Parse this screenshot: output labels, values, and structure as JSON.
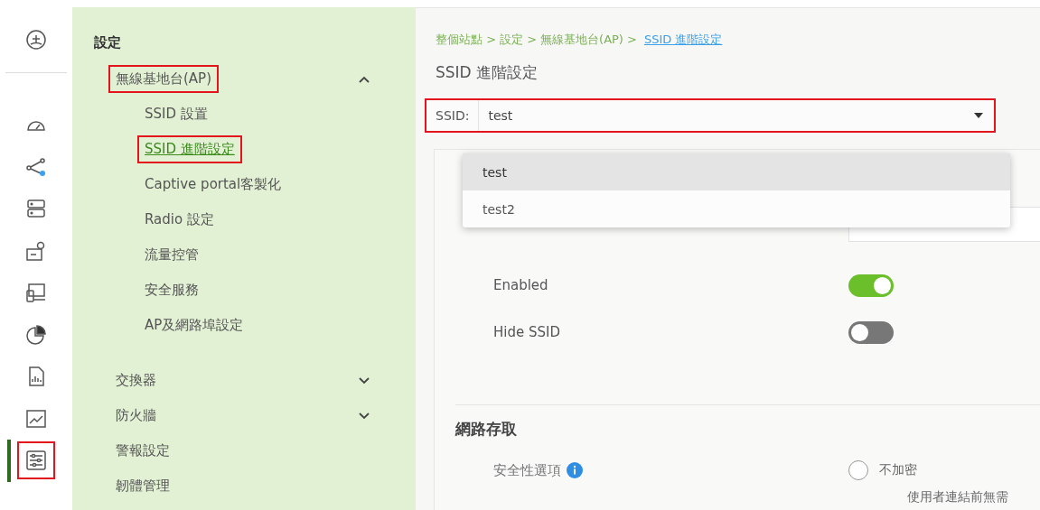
{
  "rail": [
    {
      "kind": "logo",
      "selected": false,
      "highlighted": false
    },
    {
      "kind": "gauge",
      "selected": false,
      "highlighted": false
    },
    {
      "kind": "topology",
      "selected": false,
      "highlighted": false
    },
    {
      "kind": "server",
      "selected": false,
      "highlighted": false
    },
    {
      "kind": "location",
      "selected": false,
      "highlighted": false
    },
    {
      "kind": "devices",
      "selected": false,
      "highlighted": false
    },
    {
      "kind": "pie",
      "selected": false,
      "highlighted": false
    },
    {
      "kind": "report",
      "selected": false,
      "highlighted": false
    },
    {
      "kind": "chart",
      "selected": false,
      "highlighted": false
    },
    {
      "kind": "sliders",
      "selected": true,
      "highlighted": true
    }
  ],
  "nav": {
    "title": "設定",
    "items": [
      {
        "kind": "group",
        "label": "無線基地台(AP)",
        "expanded": true,
        "highlighted": true,
        "children": [
          {
            "label": "SSID 設置",
            "selected": false,
            "highlighted": false
          },
          {
            "label": "SSID 進階設定",
            "selected": true,
            "highlighted": true
          },
          {
            "label": "Captive portal客製化",
            "selected": false,
            "highlighted": false
          },
          {
            "label": "Radio 設定",
            "selected": false,
            "highlighted": false
          },
          {
            "label": "流量控管",
            "selected": false,
            "highlighted": false
          },
          {
            "label": "安全服務",
            "selected": false,
            "highlighted": false
          },
          {
            "label": "AP及網路埠設定",
            "selected": false,
            "highlighted": false
          }
        ]
      },
      {
        "kind": "group",
        "label": "交換器",
        "expanded": false,
        "highlighted": false
      },
      {
        "kind": "group",
        "label": "防火牆",
        "expanded": false,
        "highlighted": false
      },
      {
        "kind": "item",
        "label": "警報設定",
        "highlighted": false
      },
      {
        "kind": "item",
        "label": "韌體管理",
        "highlighted": false
      }
    ]
  },
  "breadcrumb": {
    "parts": [
      "整個站點 >",
      "設定 >",
      "無線基地台(AP) >"
    ],
    "current": "SSID 進階設定"
  },
  "title": "SSID 進階設定",
  "select": {
    "label": "SSID:",
    "value": "test",
    "highlighted": true,
    "open": true,
    "options": [
      {
        "label": "test",
        "selected": true
      },
      {
        "label": "test2",
        "selected": false
      }
    ]
  },
  "toggles": [
    {
      "label": "Enabled",
      "on": true
    },
    {
      "label": "Hide SSID",
      "on": false
    }
  ],
  "access": {
    "title": "網路存取",
    "security_label": "安全性選項",
    "option": {
      "label": "不加密",
      "selected": false
    },
    "note": "使用者連結前無需"
  }
}
